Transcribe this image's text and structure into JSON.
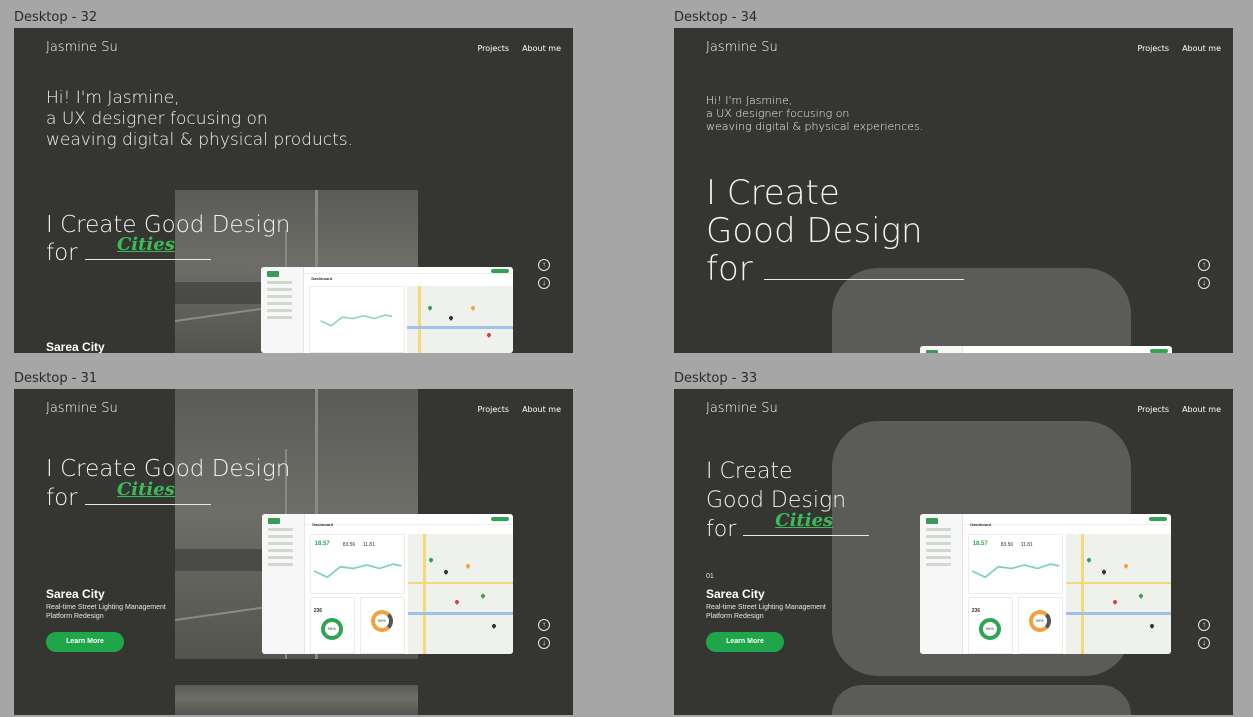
{
  "frames": {
    "f32": {
      "label": "Desktop - 32"
    },
    "f34": {
      "label": "Desktop - 34"
    },
    "f31": {
      "label": "Desktop - 31"
    },
    "f33": {
      "label": "Desktop - 33"
    }
  },
  "header": {
    "logo": "Jasmine Su",
    "nav_projects": "Projects",
    "nav_about": "About me"
  },
  "intro": {
    "f32": [
      "Hi! I'm Jasmine,",
      "a UX designer focusing on",
      "weaving digital & physical products."
    ],
    "f34": [
      "Hi! I'm Jasmine,",
      "a UX designer focusing on",
      "weaving digital & physical experiences."
    ]
  },
  "hero": {
    "line1": "I Create Good Design",
    "line_a": "I Create",
    "line_b": "Good Design",
    "for": "for",
    "word": "Cities"
  },
  "project": {
    "number": "01",
    "title": "Sarea City",
    "subtitle_1": "Real-time Street Lighting Management",
    "subtitle_2": "Platform Redesign",
    "cta": "Learn More"
  },
  "dashboard": {
    "title": "Dashboard",
    "kpi_1": "18.57",
    "kpi_2": "83.56",
    "kpi_3": "11.81",
    "connectivity_count": "236",
    "donut_1": "95%",
    "donut_2": "59%",
    "map_label": "Map"
  },
  "icons": {
    "up": "arrow-up-circle-icon",
    "down": "arrow-down-circle-icon"
  },
  "colors": {
    "background": "#353631",
    "accent": "#1fa64a",
    "canvas": "#a6a6a6"
  }
}
